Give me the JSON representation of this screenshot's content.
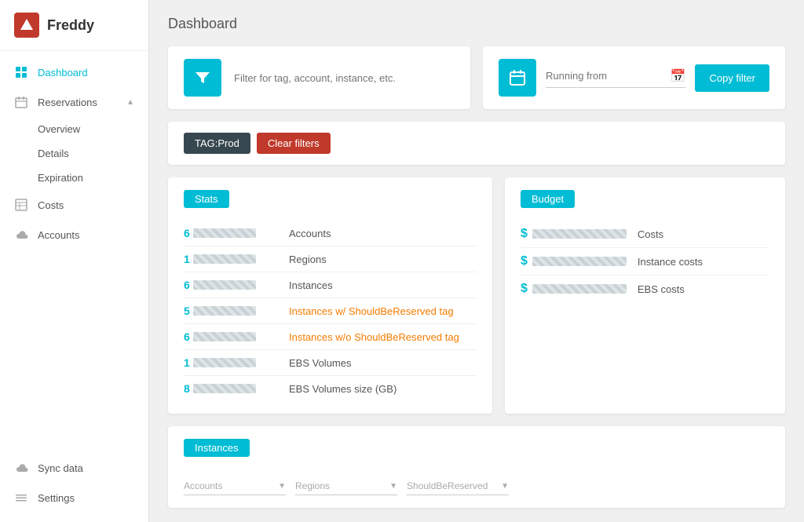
{
  "app": {
    "name": "Freddy"
  },
  "sidebar": {
    "nav_items": [
      {
        "id": "dashboard",
        "label": "Dashboard",
        "icon": "grid",
        "active": true,
        "sub": []
      },
      {
        "id": "reservations",
        "label": "Reservations",
        "icon": "calendar",
        "active": false,
        "expanded": true,
        "sub": [
          {
            "id": "overview",
            "label": "Overview"
          },
          {
            "id": "details",
            "label": "Details"
          },
          {
            "id": "expiration",
            "label": "Expiration"
          }
        ]
      },
      {
        "id": "costs",
        "label": "Costs",
        "icon": "table",
        "active": false,
        "sub": []
      },
      {
        "id": "accounts",
        "label": "Accounts",
        "icon": "cloud",
        "active": false,
        "sub": []
      }
    ],
    "bottom_items": [
      {
        "id": "sync-data",
        "label": "Sync data",
        "icon": "cloud"
      },
      {
        "id": "settings",
        "label": "Settings",
        "icon": "list"
      }
    ]
  },
  "page": {
    "title": "Dashboard"
  },
  "filter_card": {
    "placeholder": "Filter for tag, account, instance, etc."
  },
  "date_card": {
    "running_from_label": "Running from",
    "copy_filter_label": "Copy filter"
  },
  "active_filters": [
    {
      "label": "TAG:Prod"
    }
  ],
  "clear_filters_label": "Clear filters",
  "stats": {
    "badge_label": "Stats",
    "rows": [
      {
        "digit": "6",
        "label": "Accounts",
        "label_class": ""
      },
      {
        "digit": "1",
        "label": "Regions",
        "label_class": ""
      },
      {
        "digit": "6",
        "label": "Instances",
        "label_class": ""
      },
      {
        "digit": "5",
        "label": "Instances w/ ShouldBeReserved tag",
        "label_class": "orange"
      },
      {
        "digit": "6",
        "label": "Instances w/o ShouldBeReserved tag",
        "label_class": "orange"
      },
      {
        "digit": "1",
        "label": "EBS Volumes",
        "label_class": ""
      },
      {
        "digit": "8",
        "label": "EBS Volumes size (GB)",
        "label_class": ""
      }
    ]
  },
  "budget": {
    "badge_label": "Budget",
    "rows": [
      {
        "label": "Costs"
      },
      {
        "label": "Instance costs"
      },
      {
        "label": "EBS costs"
      }
    ]
  },
  "instances": {
    "badge_label": "Instances",
    "dropdowns": [
      {
        "label": "Accounts"
      },
      {
        "label": "Regions"
      },
      {
        "label": "ShouldBeReserved"
      }
    ]
  }
}
